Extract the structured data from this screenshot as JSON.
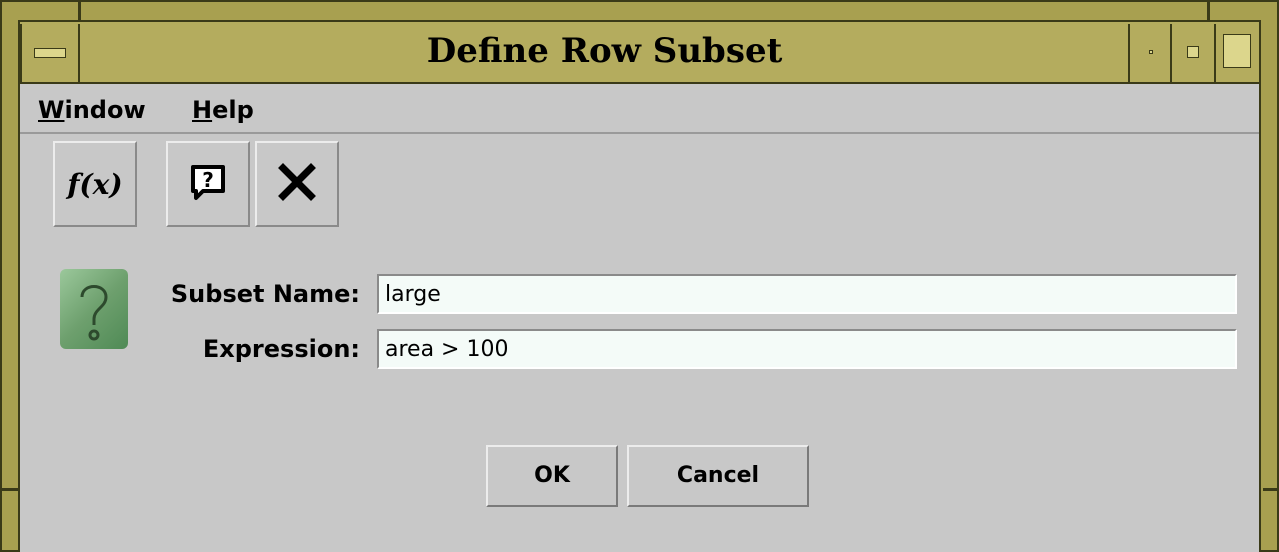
{
  "window": {
    "title": "Define Row Subset"
  },
  "menubar": {
    "items": [
      {
        "label": "Window",
        "mnemonic": "W",
        "rest": "indow"
      },
      {
        "label": "Help",
        "mnemonic": "H",
        "rest": "elp"
      }
    ]
  },
  "toolbar": {
    "buttons": [
      {
        "icon": "function-fx-icon",
        "glyph": "f(x)"
      },
      {
        "icon": "help-bubble-icon",
        "glyph": "?"
      },
      {
        "icon": "close-x-icon",
        "glyph": "✕"
      }
    ]
  },
  "form": {
    "subset_name_label": "Subset Name:",
    "subset_name_value": "large",
    "expression_label": "Expression:",
    "expression_value": "area > 100"
  },
  "buttons": {
    "ok": "OK",
    "cancel": "Cancel"
  },
  "colors": {
    "title_bar": "#b4ac5e",
    "frame": "#a8a050",
    "background": "#c8c8c8",
    "field_background": "#f4fbf8"
  }
}
